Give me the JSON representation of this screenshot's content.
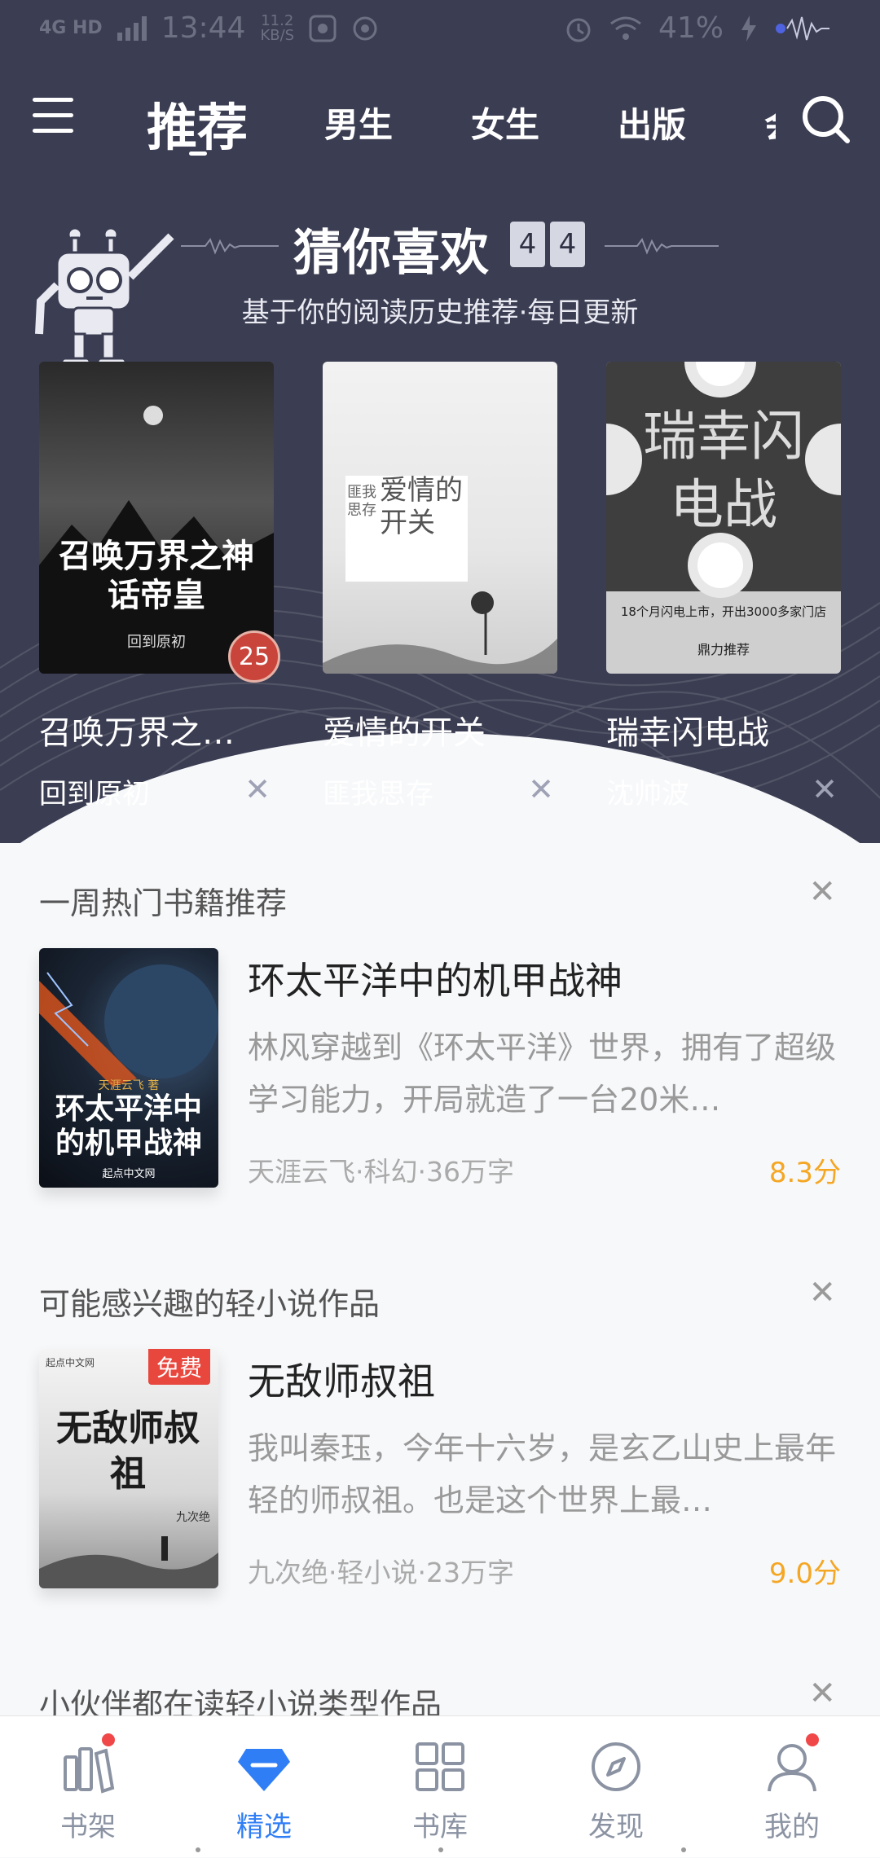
{
  "status_bar": {
    "network": "4G HD",
    "time": "13:44",
    "speed_value": "11.2",
    "speed_unit": "KB/S",
    "battery": "41%"
  },
  "nav": {
    "tabs": [
      "推荐",
      "男生",
      "女生",
      "出版",
      "会"
    ],
    "active_tab": "推荐"
  },
  "guess": {
    "title": "猜你喜欢",
    "counter": [
      "4",
      "4"
    ],
    "subtitle": "基于你的阅读历史推荐·每日更新",
    "books": [
      {
        "title": "召唤万界之…",
        "author": "回到原初",
        "badge": "25",
        "cover_title": "召唤万界之神话帝皇",
        "cover_author": "回到原初"
      },
      {
        "title": "爱情的开关",
        "author": "匪我思存",
        "cover_title": "爱情的开关",
        "cover_author": "匪我思存"
      },
      {
        "title": "瑞幸闪电战",
        "author": "沈帅波",
        "cover_title": "瑞幸闪电战",
        "cover_line": "18个月闪电上市，开出3000多家门店",
        "cover_bottom": "鼎力推荐"
      }
    ]
  },
  "sections": [
    {
      "title": "一周热门书籍推荐",
      "book": {
        "title": "环太平洋中的机甲战神",
        "desc": "林风穿越到《环太平洋》世界，拥有了超级学习能力，开局就造了一台20米…",
        "meta": "天涯云飞·科幻·36万字",
        "score": "8.3分",
        "cover_text": "环太平洋中的机甲战神",
        "cover_author": "天涯云飞 著",
        "cover_brand": "起点中文网"
      }
    },
    {
      "title": "可能感兴趣的轻小说作品",
      "book": {
        "title": "无敌师叔祖",
        "desc": "我叫秦珏，今年十六岁，是玄乙山史上最年轻的师叔祖。也是这个世界上最…",
        "meta": "九次绝·轻小说·23万字",
        "score": "9.0分",
        "tag": "免费",
        "cover_text": "无敌师叔祖",
        "cover_author": "九次绝",
        "cover_brand": "起点中文网"
      }
    },
    {
      "title": "小伙伴都在读轻小说类型作品"
    }
  ],
  "tabbar": [
    {
      "label": "书架",
      "icon": "bookshelf-icon",
      "dot": true
    },
    {
      "label": "精选",
      "icon": "diamond-icon",
      "active": true
    },
    {
      "label": "书库",
      "icon": "grid-icon"
    },
    {
      "label": "发现",
      "icon": "compass-icon"
    },
    {
      "label": "我的",
      "icon": "person-icon",
      "dot": true
    }
  ],
  "colors": {
    "header_bg": "#3b3d52",
    "accent_blue": "#2f7ef6",
    "score_orange": "#f5a623",
    "badge_red": "#e8473e"
  }
}
